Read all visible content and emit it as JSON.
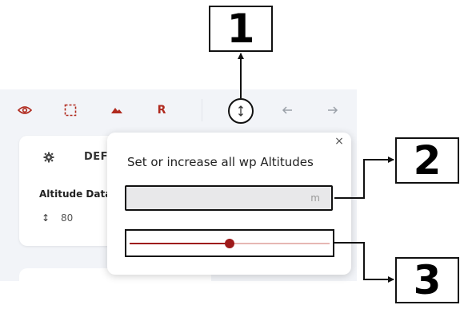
{
  "toolbar": {
    "buttons": [
      {
        "icon": "eye-icon"
      },
      {
        "icon": "dashed-square-icon"
      },
      {
        "icon": "mountain-icon"
      },
      {
        "icon": "letter-r-icon",
        "label": "R"
      },
      {
        "icon": "altitude-arrows-icon"
      },
      {
        "icon": "arrow-left-icon"
      },
      {
        "icon": "arrow-right-icon"
      }
    ],
    "accent_color": "#b02a1e"
  },
  "card": {
    "title": "DEF",
    "section_label": "Altitude Data",
    "altitude_icon": "altitude-arrows-icon",
    "altitude_glyph": "↕",
    "altitude_value": "80"
  },
  "popover": {
    "close_glyph": "×",
    "title": "Set or increase all wp Altitudes",
    "input_value": "",
    "input_unit": "m",
    "slider_value_fraction": 0.5,
    "slider_color": "#9e1a1a"
  },
  "callouts": {
    "c1": "1",
    "c2": "2",
    "c3": "3"
  }
}
